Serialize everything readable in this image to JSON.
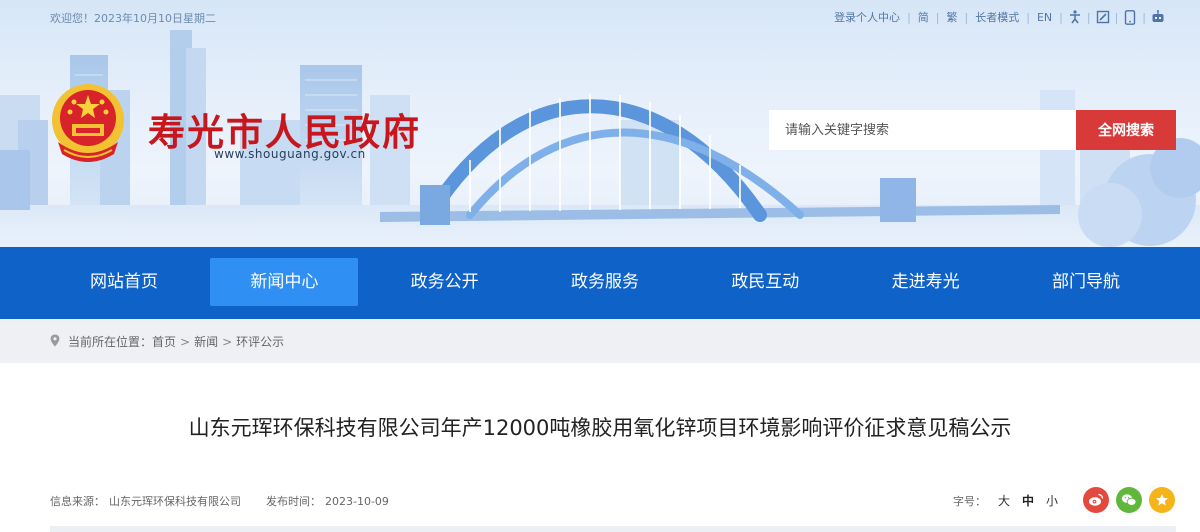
{
  "topbar": {
    "date": "欢迎您！2023年10月10日星期二",
    "links": [
      "登录个人中心",
      "简",
      "繁",
      "长者模式",
      "EN"
    ],
    "icons": [
      "accessibility-icon",
      "edit-icon",
      "mobile-icon",
      "robot-icon"
    ]
  },
  "header": {
    "title": "寿光市人民政府",
    "url": "www.shouguang.gov.cn"
  },
  "search": {
    "placeholder": "请输入关键字搜索",
    "button": "全网搜索"
  },
  "nav": {
    "items": [
      "网站首页",
      "新闻中心",
      "政务公开",
      "政务服务",
      "政民互动",
      "走进寿光",
      "部门导航"
    ],
    "active_index": 1
  },
  "breadcrumb": {
    "label": "当前所在位置：",
    "items": [
      "首页",
      "新闻",
      "环评公示"
    ],
    "separator": ">"
  },
  "article": {
    "title": "山东元珲环保科技有限公司年产12000吨橡胶用氧化锌项目环境影响评价征求意见稿公示",
    "source_label": "信息来源：",
    "source": "山东元珲环保科技有限公司",
    "time_label": "发布时间：",
    "time": "2023-10-09"
  },
  "fontsize": {
    "label": "字号：",
    "options": [
      "大",
      "中",
      "小"
    ],
    "current_index": 1
  },
  "share": [
    "weibo-icon",
    "wechat-icon",
    "favorite-icon"
  ],
  "colors": {
    "nav": "#0f62c8",
    "nav_active": "#2f8ff2",
    "title_red": "#c8161d",
    "search_button": "#d83a3a",
    "breadcrumb_bg": "#eef0f3"
  }
}
